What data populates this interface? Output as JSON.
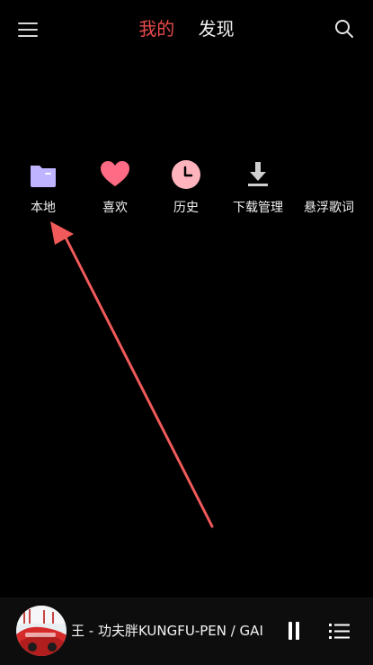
{
  "header": {
    "tabs": [
      {
        "label": "我的",
        "active": true
      },
      {
        "label": "发现",
        "active": false
      }
    ],
    "icons": [
      "menu-icon",
      "search-icon"
    ]
  },
  "quick_actions": [
    {
      "label": "本地",
      "icon": "folder-icon",
      "color": "#bfb4ff"
    },
    {
      "label": "喜欢",
      "icon": "heart-icon",
      "color": "#ff6b84"
    },
    {
      "label": "历史",
      "icon": "clock-icon",
      "color": "#ffb3bd"
    },
    {
      "label": "下载管理",
      "icon": "download-icon",
      "color": "#cfcfcf"
    },
    {
      "label": "悬浮歌词",
      "icon": "",
      "color": ""
    }
  ],
  "annotation": {
    "color": "#f15a5a"
  },
  "player": {
    "track_title": "歌王 - 功夫胖KUNGFU-PEN / GAI",
    "icons": [
      "album-art",
      "pause-icon",
      "playlist-icon"
    ]
  },
  "colors": {
    "background": "#000000",
    "accent": "#e84a4a",
    "text": "#f0f0f0"
  }
}
